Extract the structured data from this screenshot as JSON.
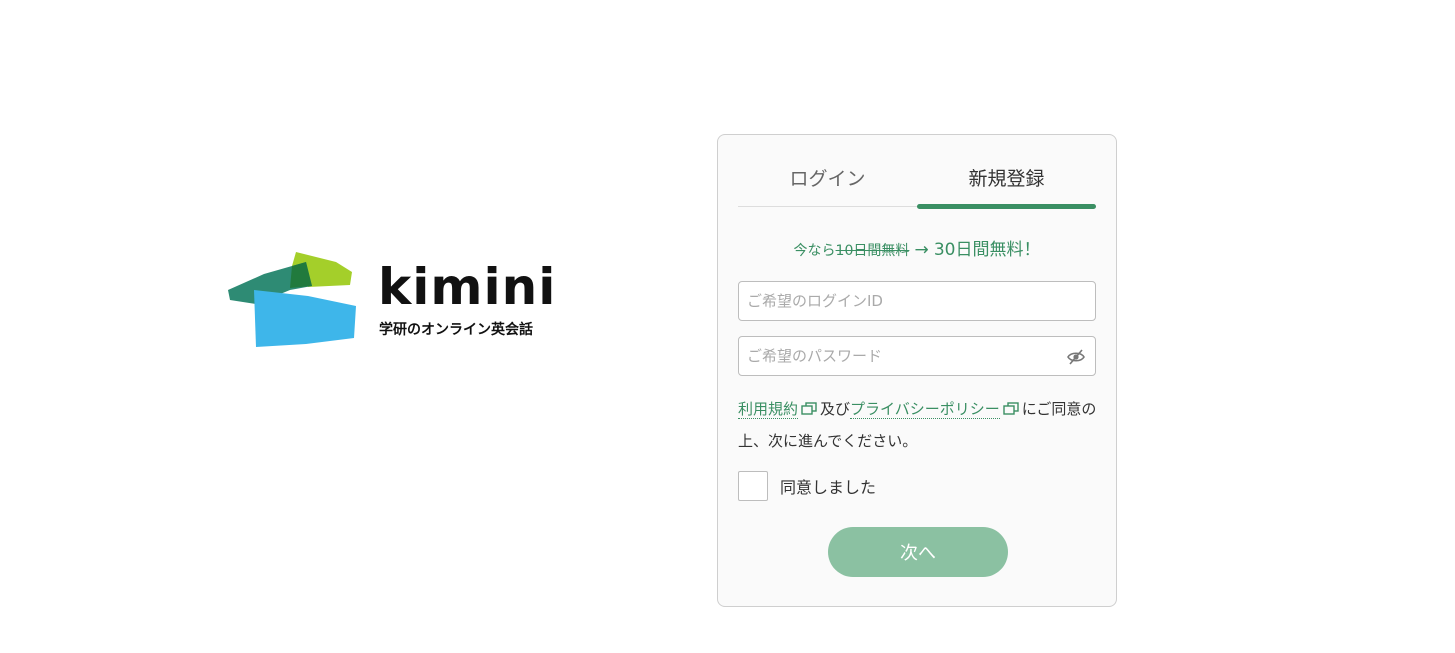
{
  "logo": {
    "word": "kimini",
    "tagline": "学研のオンライン英会話",
    "colors": {
      "lime": "#a4cf2a",
      "teal": "#2e8b74",
      "dark_green": "#217a3d",
      "sky": "#3eb6ea"
    }
  },
  "tabs": [
    {
      "label": "ログイン",
      "active": false
    },
    {
      "label": "新規登録",
      "active": true
    }
  ],
  "promo": {
    "prefix": "今なら",
    "old_offer": "10日間無料",
    "arrow": "→",
    "new_offer": "30日間無料！"
  },
  "form": {
    "login_id_placeholder": "ご希望のログインID",
    "password_placeholder": "ご希望のパスワード"
  },
  "terms": {
    "terms_link": "利用規約",
    "and": "及び",
    "privacy_link": "プライバシーポリシー",
    "suffix": "にご同意の上、次に進んでください。"
  },
  "agree": {
    "label": "同意しました",
    "checked": false
  },
  "next_button": "次へ",
  "colors": {
    "accent": "#3a8f63",
    "button_disabled": "#8bc1a2"
  }
}
